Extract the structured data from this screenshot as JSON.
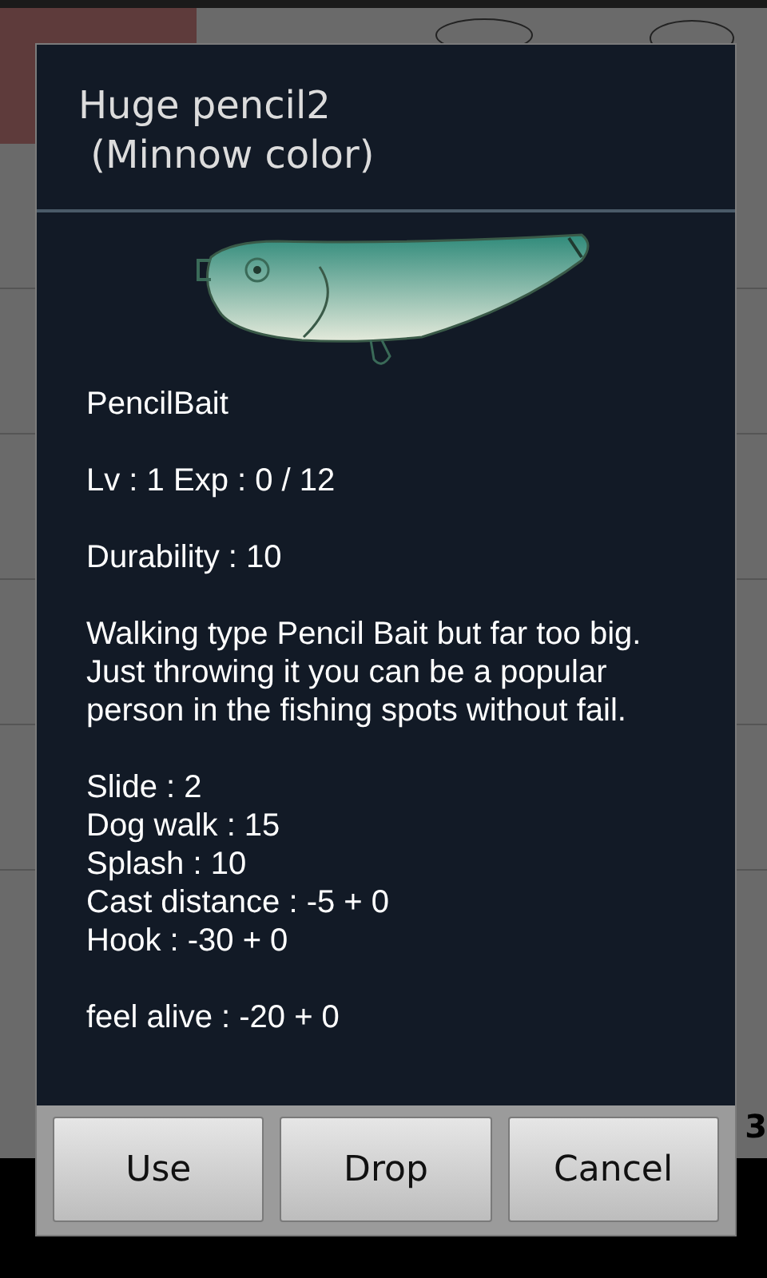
{
  "background": {
    "side_text": "3"
  },
  "dialog": {
    "title": "Huge pencil2\n (Minnow color)",
    "paragraphs": [
      [
        "PencilBait"
      ],
      [
        "Lv : 1 Exp : 0 / 12"
      ],
      [
        "Durability : 10"
      ],
      [
        "Walking type Pencil Bait but far too big. Just throwing it you can be a popular person in the fishing spots without fail."
      ],
      [
        "Slide : 2",
        "Dog walk : 15",
        "Splash : 10",
        "Cast distance : -5 + 0",
        "Hook : -30 + 0"
      ],
      [
        "feel alive : -20 + 0"
      ]
    ],
    "buttons": [
      "Use",
      "Drop",
      "Cancel"
    ]
  }
}
